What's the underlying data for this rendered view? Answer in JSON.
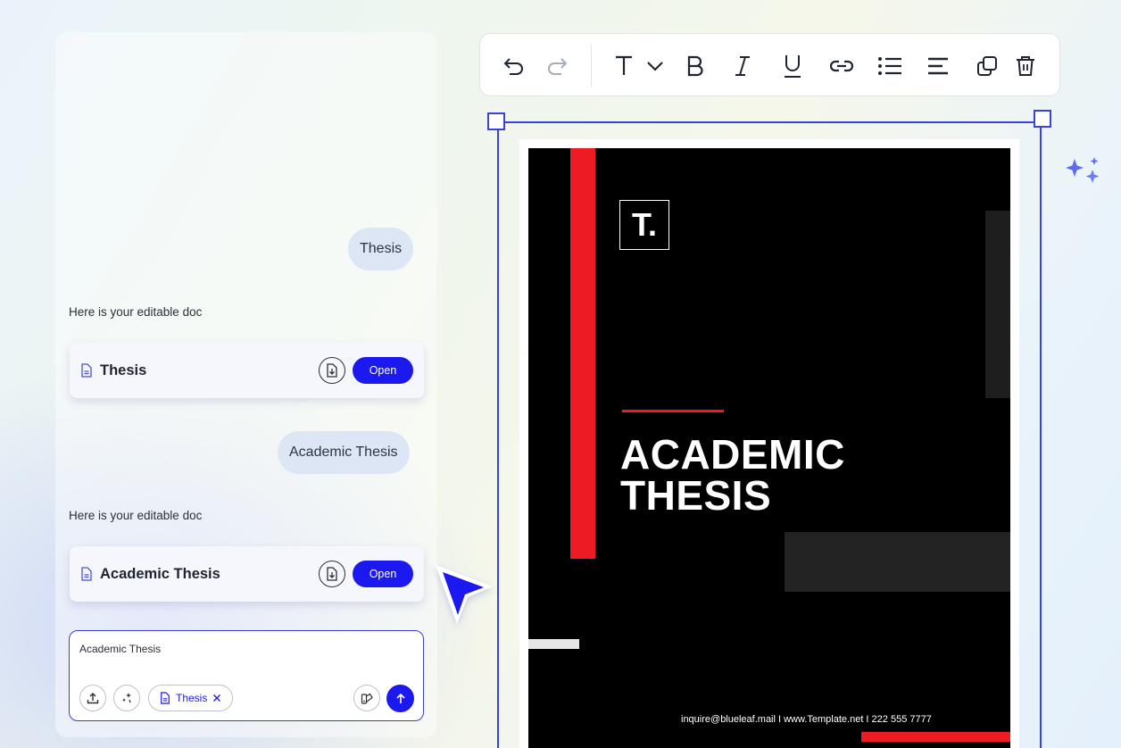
{
  "chat": {
    "messages": [
      {
        "role": "user",
        "text": "Thesis"
      },
      {
        "role": "assistant",
        "text": "Here is your editable doc",
        "doc_title": "Thesis",
        "open_label": "Open"
      },
      {
        "role": "user",
        "text": "Academic Thesis"
      },
      {
        "role": "assistant",
        "text": "Here is your editable doc",
        "doc_title": "Academic Thesis",
        "open_label": "Open"
      }
    ]
  },
  "composer": {
    "value": "Academic Thesis",
    "attachment_chip": "Thesis"
  },
  "toolbar": {
    "items": [
      "undo-icon",
      "redo-icon",
      "text-style-icon",
      "bold-icon",
      "italic-icon",
      "underline-icon",
      "link-icon",
      "bullet-list-icon",
      "align-left-icon",
      "duplicate-icon",
      "delete-icon"
    ]
  },
  "document": {
    "logo_text": "T.",
    "heading_line1": "ACADEMIC",
    "heading_line2": "THESIS",
    "footer": "inquire@blueleaf.mail  I  www.Template.net  I  222 555 7777"
  },
  "colors": {
    "accent": "#1c19f0",
    "selection": "#3742e0",
    "doc_red": "#ed1c24",
    "doc_bg": "#000000"
  }
}
